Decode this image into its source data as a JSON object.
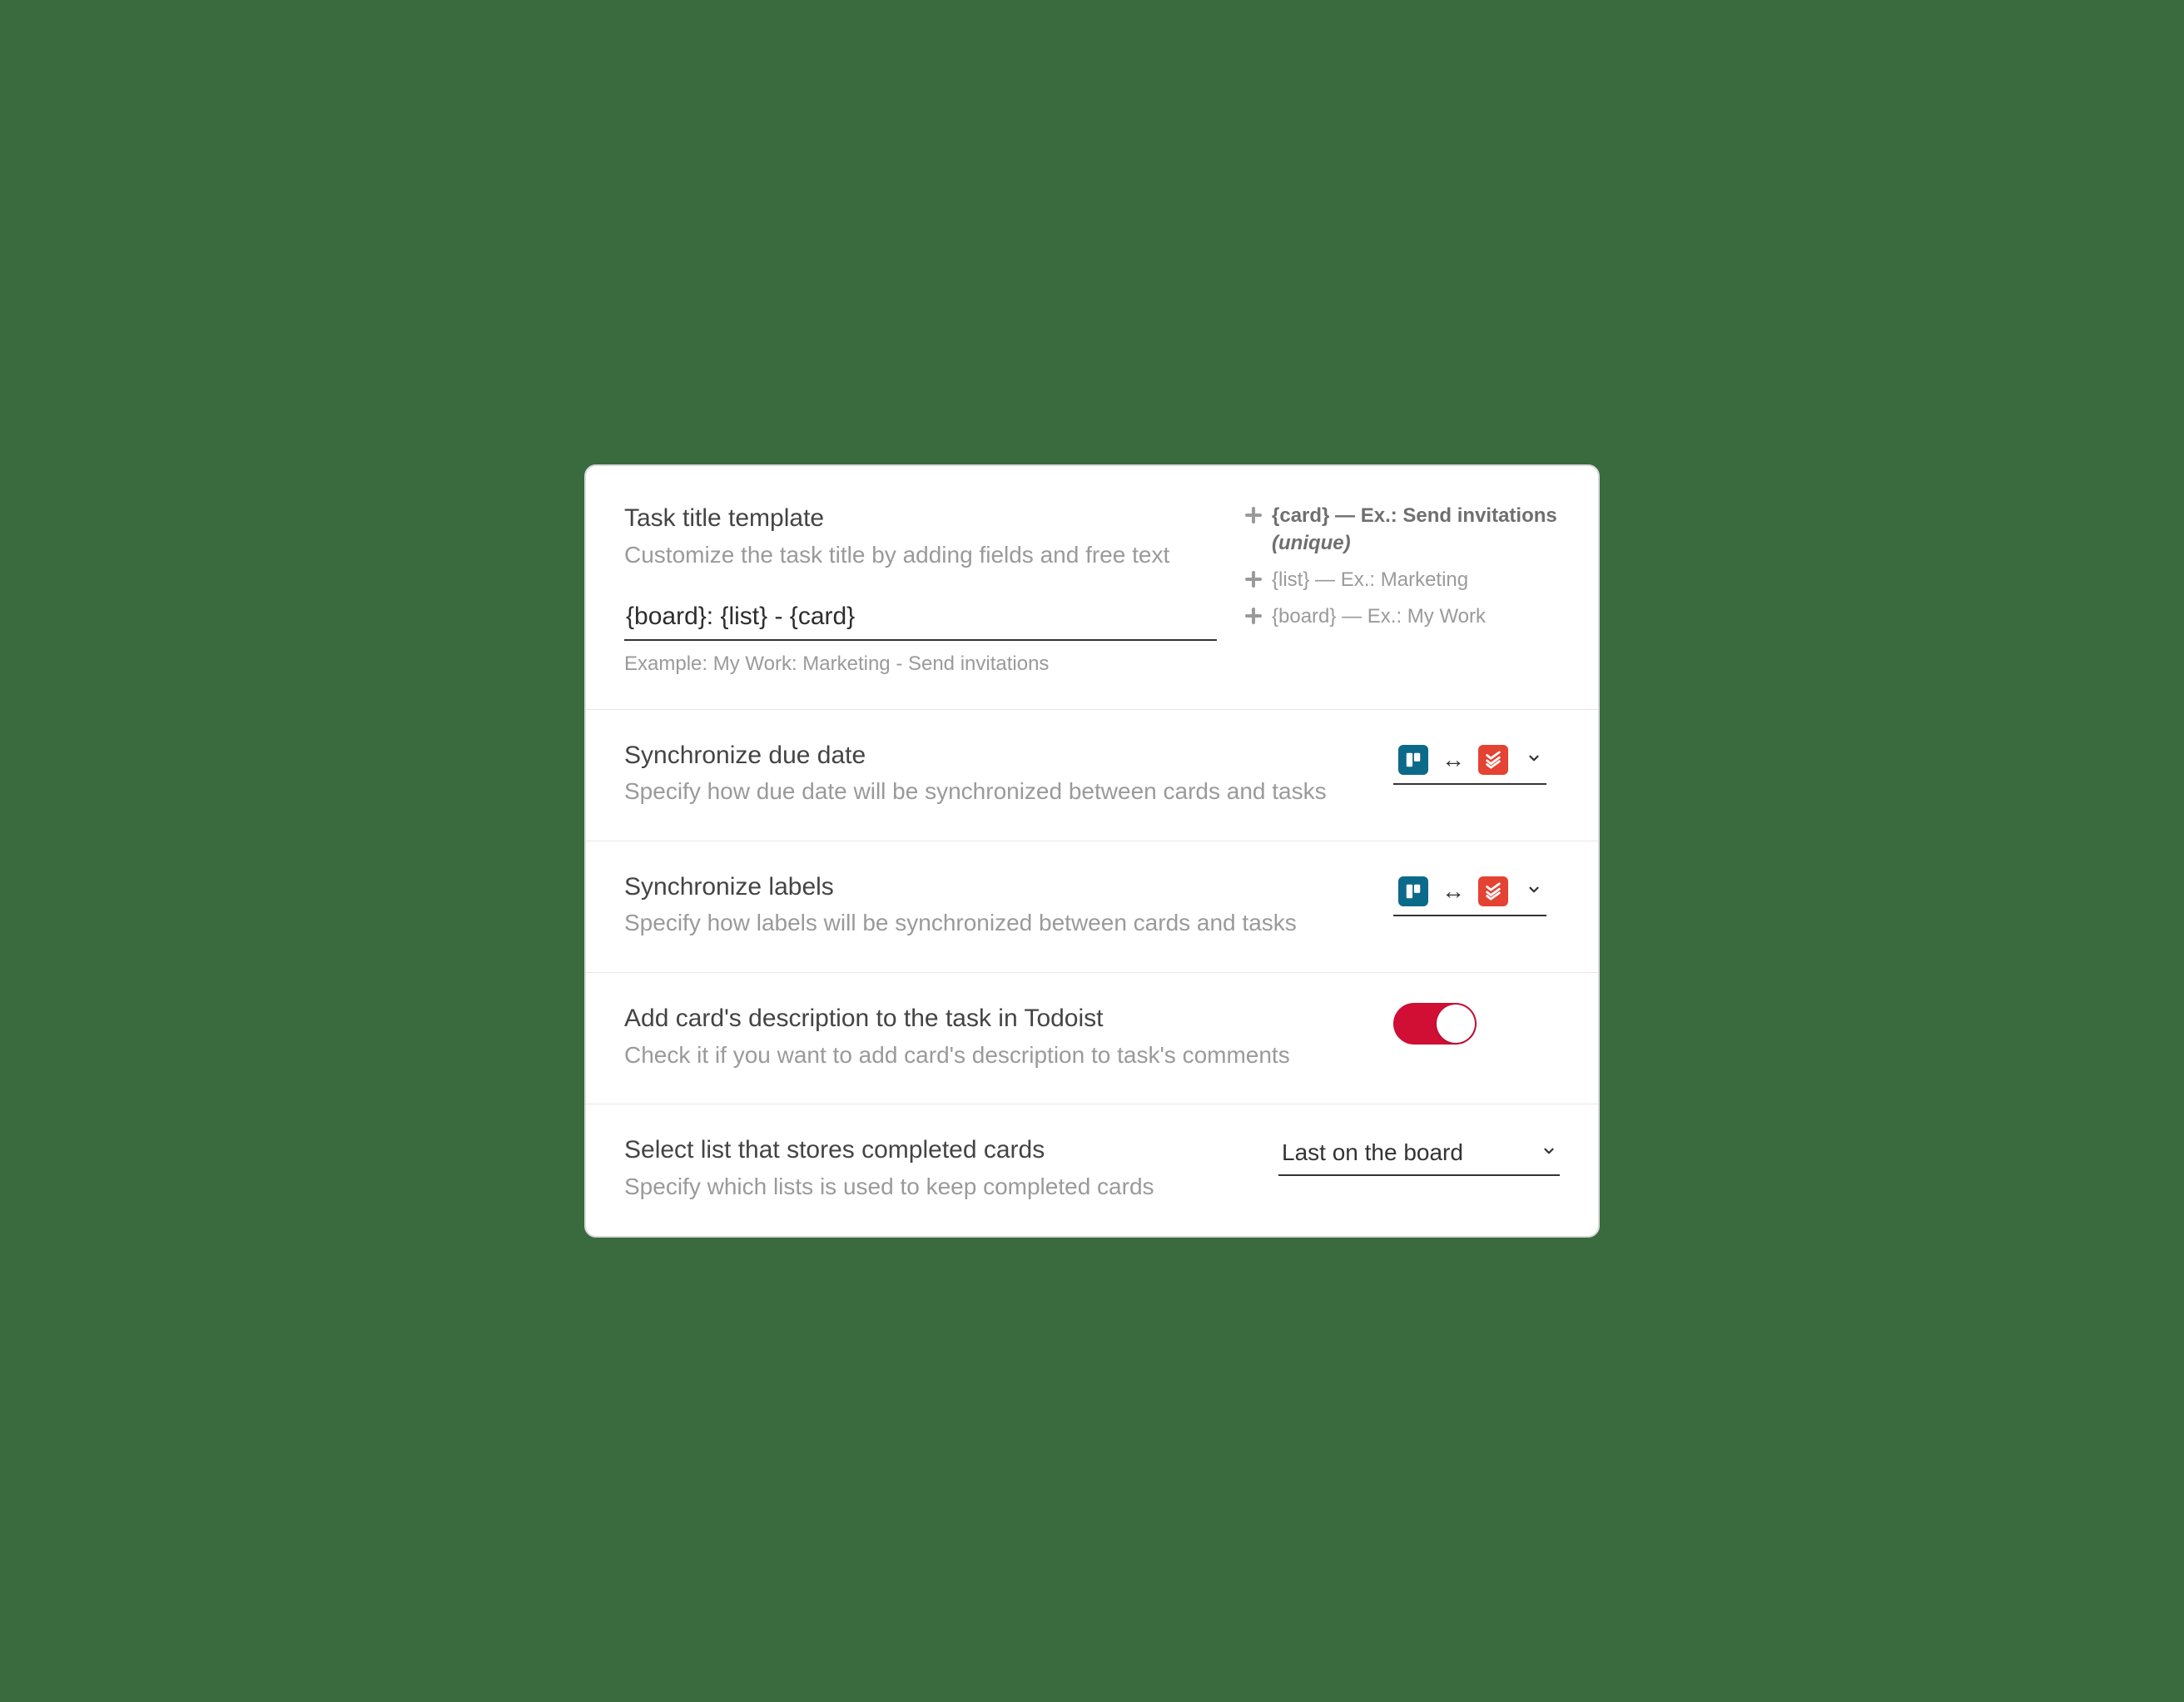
{
  "template": {
    "title": "Task title template",
    "subtitle": "Customize the task title by adding fields and free text",
    "value": "{board}: {list} - {card}",
    "example_prefix": "Example: ",
    "example": "My Work: Marketing - Send invitations",
    "tokens": [
      {
        "tag": "{card}",
        "example": "Ex.: Send invitations",
        "unique": "(unique)",
        "bold": true
      },
      {
        "tag": "{list}",
        "example": "Ex.: Marketing",
        "bold": false
      },
      {
        "tag": "{board}",
        "example": "Ex.: My Work",
        "bold": false
      }
    ]
  },
  "sync_due": {
    "title": "Synchronize due date",
    "subtitle": "Specify how due date will be synchronized between cards and tasks",
    "direction": "both"
  },
  "sync_labels": {
    "title": "Synchronize labels",
    "subtitle": "Specify how labels will be synchronized between cards and tasks",
    "direction": "both"
  },
  "add_description": {
    "title": "Add card's description to the task in Todoist",
    "subtitle": "Check it if you want to add card's description to task's comments",
    "enabled": true
  },
  "completed_list": {
    "title": "Select list that stores completed cards",
    "subtitle": "Specify which lists is used to keep completed cards",
    "value": "Last on the board"
  },
  "icons": {
    "trello": "trello-icon",
    "todoist": "todoist-icon",
    "plus": "plus-icon",
    "chevron": "chevron-down-icon",
    "bidir": "bidirectional-arrow-icon"
  },
  "colors": {
    "toggle_on": "#d10f35",
    "trello": "#0b6a89",
    "todoist": "#e44232"
  }
}
